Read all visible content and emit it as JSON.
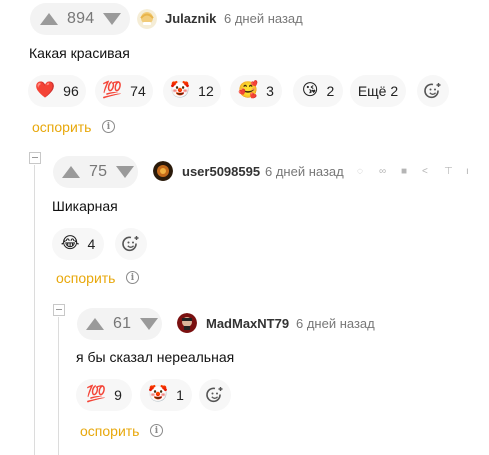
{
  "comments": [
    {
      "score": "894",
      "author": "Julaznik",
      "time": "6 дней назад",
      "text": "Какая красивая",
      "reactions": [
        {
          "emoji": "❤️",
          "count": "96"
        },
        {
          "emoji": "💯",
          "count": "74"
        },
        {
          "emoji": "🤡",
          "count": "12"
        },
        {
          "emoji": "🥰",
          "count": "3"
        },
        {
          "emoji": "😘",
          "count": "2"
        }
      ],
      "more_reactions": "Ещё 2",
      "dispute": "оспорить"
    },
    {
      "score": "75",
      "author": "user5098595",
      "time": "6 дней назад",
      "text": "Шикарная",
      "reactions": [
        {
          "emoji": "😂",
          "count": "4"
        }
      ],
      "dispute": "оспорить"
    },
    {
      "score": "61",
      "author": "MadMaxNT79",
      "time": "6 дней назад",
      "text": "я бы сказал нереальная",
      "reactions": [
        {
          "emoji": "💯",
          "count": "9"
        },
        {
          "emoji": "🤡",
          "count": "1"
        }
      ],
      "dispute": "оспорить"
    }
  ],
  "icons": {
    "add_reaction": "smiley-plus-icon",
    "info": "info-icon",
    "upvote": "arrow-up-icon",
    "downvote": "arrow-down-icon",
    "toolbar": [
      "rss-icon",
      "link-icon",
      "save-icon",
      "share-icon",
      "scroll-top-icon",
      "more-icon"
    ]
  },
  "colors": {
    "dispute": "#e8a80c",
    "vote_arrow": "#9a9a9a",
    "chip_bg": "#f7f7f7"
  }
}
